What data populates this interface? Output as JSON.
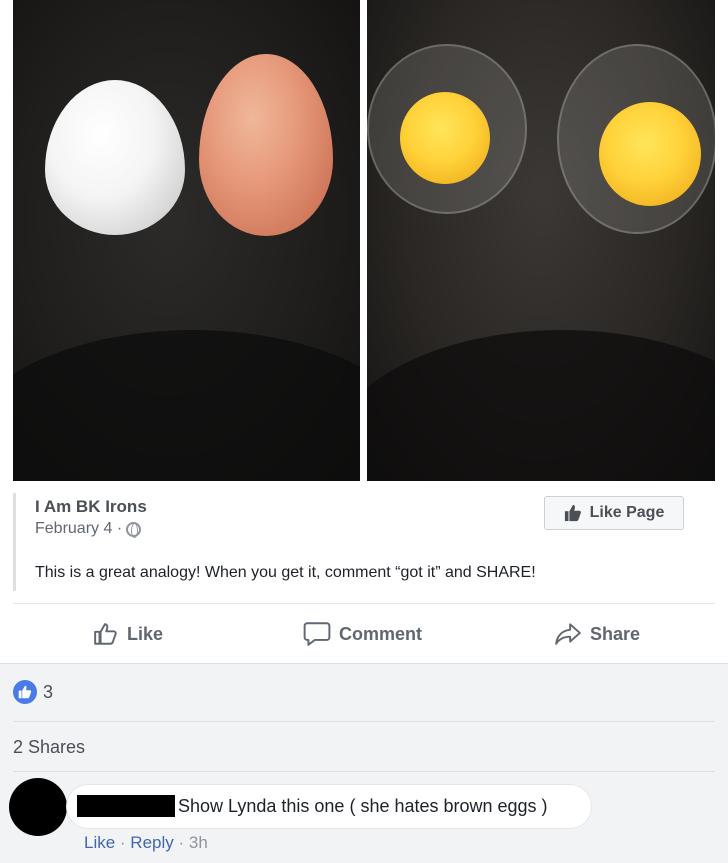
{
  "post": {
    "author": "I Am BK Irons",
    "date": "February 4 ·",
    "privacy_icon": "globe-icon",
    "text": "This is a great analogy! When you get it, comment “got it” and SHARE!",
    "like_page_label": "Like Page",
    "photo_left_content": [
      "white-egg",
      "brown-egg"
    ],
    "photo_right_content": [
      "cracked-egg",
      "cracked-egg"
    ]
  },
  "actions": {
    "like_label": "Like",
    "comment_label": "Comment",
    "share_label": "Share"
  },
  "stats": {
    "reaction_count": "3",
    "shares_label": "2 Shares"
  },
  "comment": {
    "text": "Show Lynda this one ( she hates brown eggs )",
    "like_label": "Like",
    "separator1": " · ",
    "reply_label": "Reply",
    "separator2": " · ",
    "time": "3h"
  },
  "colors": {
    "link_blue": "#4267b2",
    "like_blue": "#4a7be8",
    "panel_grey": "#f2f3f5"
  }
}
